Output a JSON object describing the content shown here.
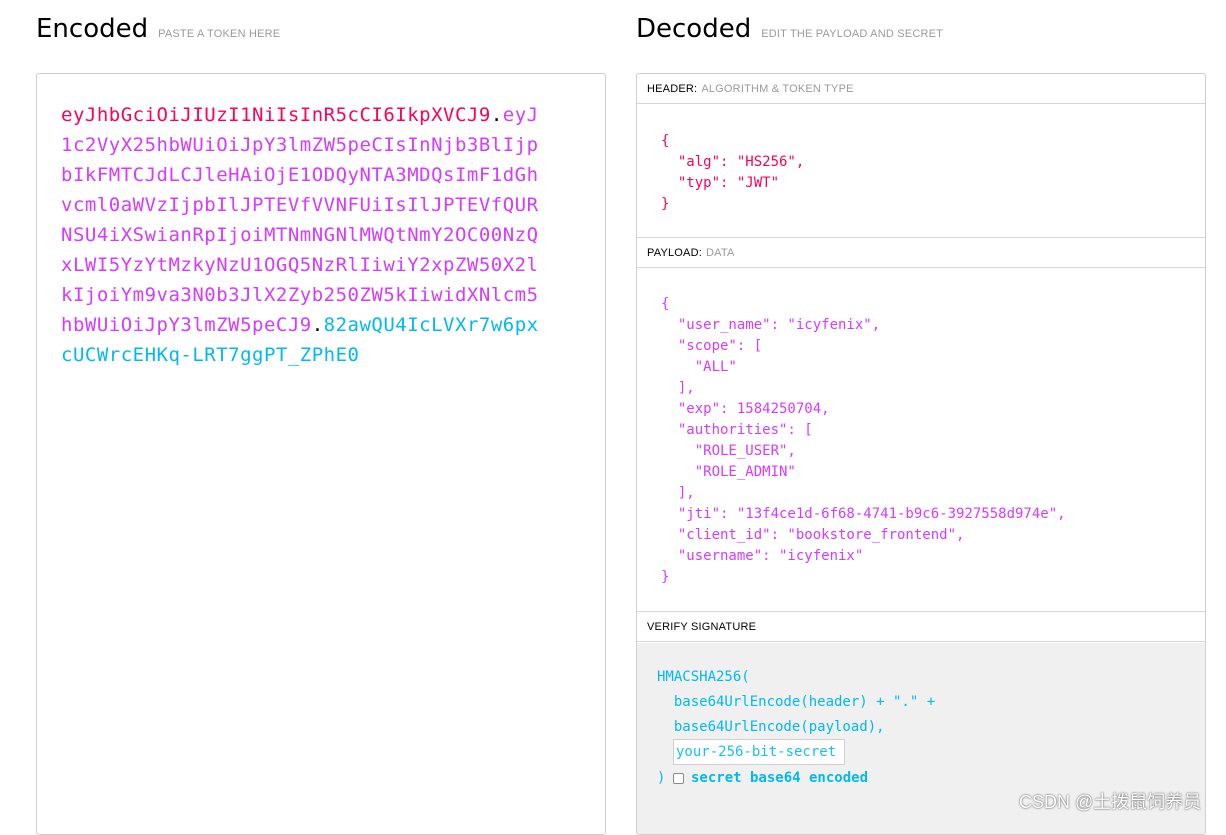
{
  "encoded": {
    "title": "Encoded",
    "subtitle": "PASTE A TOKEN HERE",
    "token_lines": [
      [
        {
          "t": "eyJhbGciOiJIUzI1NiIsInR5cCI6IkpXVCJ9",
          "c": "h"
        },
        {
          "t": ".",
          "c": "d"
        },
        {
          "t": "eyJ",
          "c": "p"
        }
      ],
      [
        {
          "t": "1c2VyX25hbWUiOiJpY3lmZW5peCIsInNjb3BlIjp",
          "c": "p"
        }
      ],
      [
        {
          "t": "bIkFMTCJdLCJleHAiOjE1ODQyNTA3MDQsImF1dGh",
          "c": "p"
        }
      ],
      [
        {
          "t": "vcml0aWVzIjpbIlJPTEVfVVNFUiIsIlJPTEVfQUR",
          "c": "p"
        }
      ],
      [
        {
          "t": "NSU4iXSwianRpIjoiMTNmNGNlMWQtNmY2OC00NzQ",
          "c": "p"
        }
      ],
      [
        {
          "t": "xLWI5YzYtMzkyNzU1OGQ5NzRlIiwiY2xpZW50X2l",
          "c": "p"
        }
      ],
      [
        {
          "t": "kIjoiYm9va3N0b3JlX2Zyb250ZW5kIiwidXNlcm5",
          "c": "p"
        }
      ],
      [
        {
          "t": "hbWUiOiJpY3lmZW5peCJ9",
          "c": "p"
        },
        {
          "t": ".",
          "c": "d"
        },
        {
          "t": "82awQU4IcLVXr7w6px",
          "c": "s"
        }
      ],
      [
        {
          "t": "cUCWrcEHKq-LRT7ggPT_ZPhE0",
          "c": "s"
        }
      ]
    ]
  },
  "decoded": {
    "title": "Decoded",
    "subtitle": "EDIT THE PAYLOAD AND SECRET",
    "header_section": {
      "label": "HEADER:",
      "sublabel": "ALGORITHM & TOKEN TYPE",
      "lines": [
        "{",
        "  \"alg\": \"HS256\",",
        "  \"typ\": \"JWT\"",
        "}"
      ]
    },
    "payload_section": {
      "label": "PAYLOAD:",
      "sublabel": "DATA",
      "lines": [
        "{",
        "  \"user_name\": \"icyfenix\",",
        "  \"scope\": [",
        "    \"ALL\"",
        "  ],",
        "  \"exp\": 1584250704,",
        "  \"authorities\": [",
        "    \"ROLE_USER\",",
        "    \"ROLE_ADMIN\"",
        "  ],",
        "  \"jti\": \"13f4ce1d-6f68-4741-b9c6-3927558d974e\",",
        "  \"client_id\": \"bookstore_frontend\",",
        "  \"username\": \"icyfenix\"",
        "}"
      ]
    },
    "verify_section": {
      "label": "VERIFY SIGNATURE",
      "line1": "HMACSHA256(",
      "line2": "  base64UrlEncode(header) + \".\" +",
      "line3": "  base64UrlEncode(payload),",
      "secret_placeholder": "your-256-bit-secret",
      "secret_value": "",
      "close": ")",
      "checkbox_label": "secret base64 encoded",
      "checkbox_checked": false
    }
  },
  "watermark": "CSDN @土拨鼠饲养员",
  "colors": {
    "header": "#fb015b",
    "payload": "#d63aff",
    "signature": "#00b9f1"
  }
}
